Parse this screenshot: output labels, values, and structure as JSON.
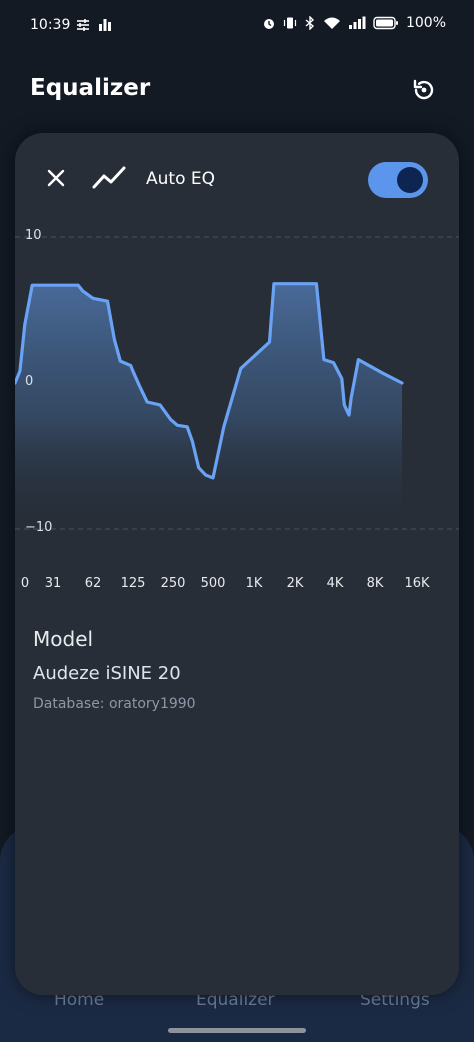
{
  "status_bar": {
    "time": "10:39",
    "battery_text": "100%"
  },
  "app_bar": {
    "title": "Equalizer",
    "reset_icon": "reset-icon"
  },
  "auto_eq": {
    "label": "Auto EQ",
    "enabled": true,
    "close_icon": "close-icon",
    "trend_icon": "trend-icon"
  },
  "colors": {
    "accent": "#5b95ec",
    "curve": "#6aa3f5",
    "card": "#272e38",
    "background": "#131a24"
  },
  "chart_data": {
    "type": "area",
    "y_tick_labels": [
      "10",
      "0",
      "−10"
    ],
    "ylim": [
      -10,
      10
    ],
    "x_tick_labels": [
      "0",
      "31",
      "62",
      "125",
      "250",
      "500",
      "1K",
      "2K",
      "4K",
      "8K",
      "16K"
    ],
    "grid": "dashed horizontal at 10 and -10",
    "series": [
      {
        "points": [
          [
            0,
            0.0
          ],
          [
            4,
            0.8
          ],
          [
            8,
            4.0
          ],
          [
            14,
            6.7
          ],
          [
            48,
            6.7
          ],
          [
            52,
            6.3
          ],
          [
            62,
            5.8
          ],
          [
            80,
            5.6
          ],
          [
            90,
            3.0
          ],
          [
            100,
            1.5
          ],
          [
            120,
            1.2
          ],
          [
            125,
            0.8
          ],
          [
            140,
            -0.2
          ],
          [
            160,
            -1.3
          ],
          [
            200,
            -1.5
          ],
          [
            240,
            -2.5
          ],
          [
            270,
            -2.9
          ],
          [
            320,
            -3.0
          ],
          [
            350,
            -4.0
          ],
          [
            390,
            -5.8
          ],
          [
            440,
            -6.3
          ],
          [
            500,
            -6.5
          ],
          [
            600,
            -3.0
          ],
          [
            800,
            1.0
          ],
          [
            1300,
            2.8
          ],
          [
            1400,
            6.8
          ],
          [
            2900,
            6.8
          ],
          [
            3300,
            1.6
          ],
          [
            3900,
            1.4
          ],
          [
            4500,
            0.3
          ],
          [
            4700,
            -1.5
          ],
          [
            5100,
            -2.2
          ],
          [
            5300,
            -1.0
          ],
          [
            6000,
            1.6
          ],
          [
            9000,
            0.7
          ],
          [
            12500,
            0.0
          ]
        ]
      }
    ]
  },
  "model": {
    "heading": "Model",
    "name": "Audeze iSINE 20",
    "database": "Database: oratory1990"
  },
  "bottom_nav": {
    "home": "Home",
    "equalizer": "Equalizer",
    "settings": "Settings"
  }
}
